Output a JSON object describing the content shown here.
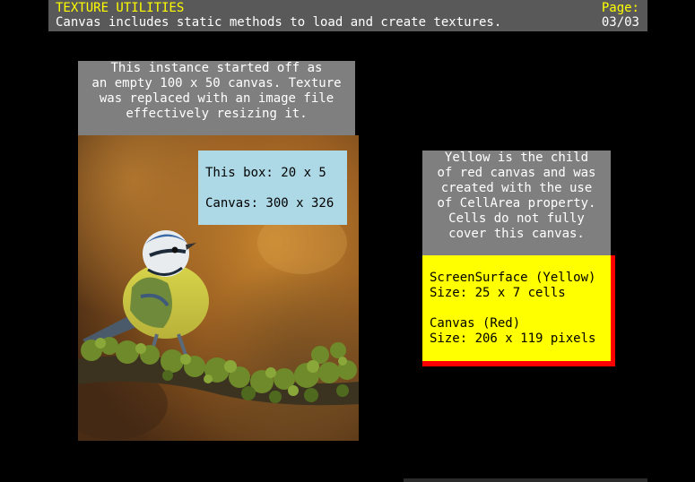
{
  "header": {
    "title": "TEXTURE UTILITIES",
    "subtitle": "Canvas includes static methods to load and create textures.",
    "page_label": "Page:",
    "page_number": "03/03"
  },
  "top_note": "This instance started off as\nan empty 100 x 50 canvas. Texture\nwas replaced with an image file\neffectively resizing it.",
  "info_box": {
    "line1": "This box: 20 x 5",
    "line2": "Canvas: 300 x 326"
  },
  "right_note": "Yellow is the child\nof red canvas and was\ncreated with the use\nof CellArea property.\nCells do not fully\ncover this canvas.",
  "yellow_surface": {
    "line1": "ScreenSurface (Yellow)",
    "line2": "Size: 25 x 7 cells",
    "line3": "Canvas (Red)",
    "line4": "Size: 206 x 119 pixels"
  },
  "colors": {
    "header_bg": "#595959",
    "accent_yellow": "#ffff00",
    "note_bg": "#7f7f7f",
    "info_bg": "#add8e6",
    "red_canvas": "#ff0000"
  }
}
